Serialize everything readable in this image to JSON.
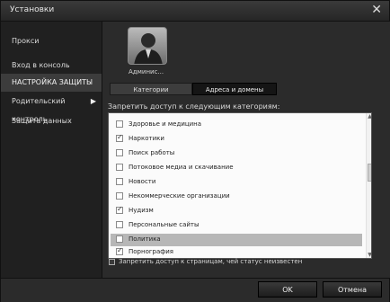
{
  "window": {
    "title": "Установки",
    "close_glyph": "✕"
  },
  "sidebar": {
    "items": [
      {
        "label": "Прокси"
      },
      {
        "label": "Вход в консоль"
      },
      {
        "label": "НАСТРОЙКА ЗАЩИТЫ"
      },
      {
        "label": "Родительский контроль",
        "arrow": "▶"
      },
      {
        "label": "Защита данных"
      }
    ]
  },
  "profile": {
    "name": "Админис..."
  },
  "tabs": [
    {
      "label": "Категории"
    },
    {
      "label": "Адреса и домены"
    }
  ],
  "section_label": "Запретить доступ к следующим категориям:",
  "categories": [
    {
      "label": "Здоровье и медицина",
      "checked": false
    },
    {
      "label": "Наркотики",
      "checked": true
    },
    {
      "label": "Поиск работы",
      "checked": false
    },
    {
      "label": "Потоковое медиа и скачивание",
      "checked": false
    },
    {
      "label": "Новости",
      "checked": false
    },
    {
      "label": "Некоммерческие организации",
      "checked": false
    },
    {
      "label": "Нудизм",
      "checked": true
    },
    {
      "label": "Персональные сайты",
      "checked": false
    },
    {
      "label": "Политика",
      "checked": false,
      "selected": true
    },
    {
      "label": "Порнография",
      "checked": true
    }
  ],
  "unknown_status_label": "Запретить доступ к страницам, чей статус неизвестен",
  "buttons": {
    "ok": "OK",
    "cancel": "Отмена"
  },
  "icons": {
    "avatar": "user-avatar-icon",
    "scroll_up": "▲",
    "scroll_down": "▼"
  }
}
